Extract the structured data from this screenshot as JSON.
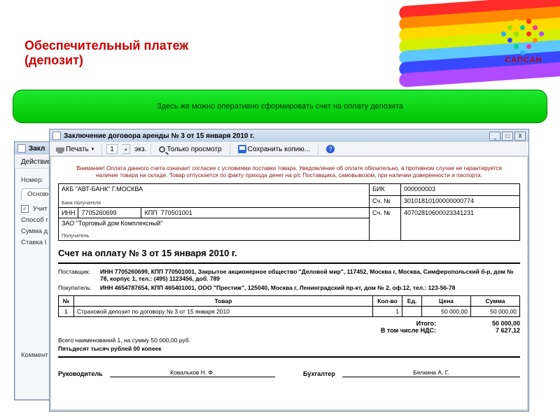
{
  "brand": {
    "label": "САПСАН"
  },
  "slide": {
    "title_line1": "Обеспечительный платеж",
    "title_line2": "(депозит)"
  },
  "banner": {
    "text": "Здесь же можно оперативно сформировать счет на оплату депозита"
  },
  "bg_window": {
    "title": "Закл",
    "actions_label": "Действия",
    "field_number": "Номер:",
    "tab_main": "Основна",
    "chk_uchit": "Учит",
    "field_sposob": "Способ г",
    "field_summa": "Сумма д",
    "field_stavka": "Ставка I",
    "field_comment": "Коммент"
  },
  "window": {
    "title": "Заключение договора аренды № 3 от 15 января 2010 г.",
    "tb_print": "Печать",
    "copies_value": "1",
    "copies_suffix": "экз.",
    "tb_view_only": "Только просмотр",
    "tb_save_copy": "Сохранить копию...",
    "help": "?",
    "min": "_",
    "max": "□",
    "close": "X"
  },
  "invoice": {
    "warning": "Внимание! Оплата данного счета означает согласие с условиями поставки товара. Уведомление об оплате обязательно, в противном случае не гарантируется наличие товара на складе. Товар отпускается по факту прихода денег на р/с Поставщика, самовывозом, при наличии доверенности и паспорта.",
    "bank_name": "АКБ \"АВТ-БАНК\" Г.МОСКВА",
    "bank_recipient_lbl": "Банк получателя",
    "bik_lbl": "БИК",
    "bik": "000000003",
    "bank_acct_lbl": "Сч. №",
    "bank_acct": "30101810100000000774",
    "inn_lbl": "ИНН",
    "inn": "7705260699",
    "kpp_lbl": "КПП",
    "kpp": "770501001",
    "payee_acct_lbl": "Сч. №",
    "payee_acct": "40702810600023341231",
    "payee_name": "ЗАО \"Торговый дом Комплексный\"",
    "payee_lbl": "Получатель",
    "heading": "Счет на оплату № 3 от 15 января 2010 г.",
    "supplier_lbl": "Поставщик:",
    "supplier": "ИНН 7705260699, КПП 770501001, Закрытое акционерное общество \"Деловой мир\", 117452, Москва г, Москва, Симферопольский б-р, дом № 78, корпус 1, тел.: (495) 1123456, доб. 789",
    "buyer_lbl": "Покупатель:",
    "buyer": "ИНН 4654787654, КПП 465401001, ООО \"Престиж\", 125040, Москва г, Ленинградский пр-кт, дом № 2, оф.12, тел.: 123-56-78",
    "col_n": "№",
    "col_goods": "Товар",
    "col_qty": "Кол-во",
    "col_unit": "Ед.",
    "col_price": "Цена",
    "col_sum": "Сумма",
    "row_n": "1",
    "row_goods": "Страховой депозит по договору № 3 от 15 января 2010",
    "row_qty": "1",
    "row_unit": "",
    "row_price": "50 000,00",
    "row_sum": "50 000,00",
    "total_lbl": "Итого:",
    "total": "50 000,00",
    "nds_lbl": "В том числе НДС:",
    "nds": "7 627,12",
    "count_line": "Всего наименований 1, на сумму 50 000,00 руб.",
    "amount_words": "Пятьдесят тысяч рублей 00 копеек",
    "mgr_lbl": "Руководитель",
    "mgr_name": "Ковальков Н. Ф.",
    "acc_lbl": "Бухгалтер",
    "acc_name": "Белкина А. Г."
  }
}
